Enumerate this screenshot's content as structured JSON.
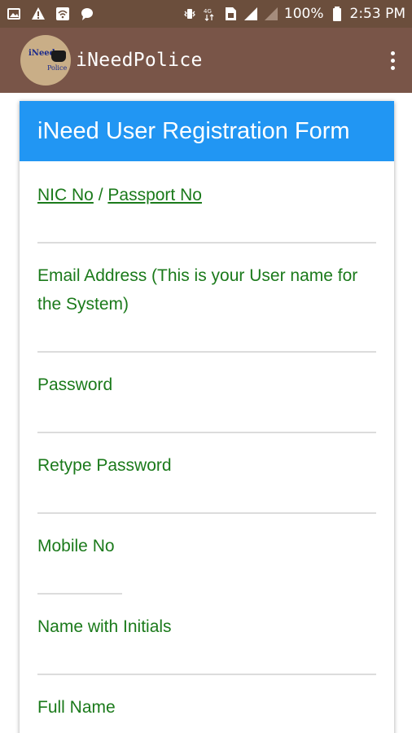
{
  "status_bar": {
    "battery": "100%",
    "time": "2:53 PM"
  },
  "app_bar": {
    "title": "iNeedPolice",
    "logo_top": "iNeed",
    "logo_bottom": "Police"
  },
  "form": {
    "title": "iNeed User Registration Form",
    "nic_label": "NIC No",
    "separator": "/",
    "passport_label": "Passport No",
    "email_label": "Email Address (This is your User name for the System)",
    "password_label": "Password",
    "retype_password_label": "Retype Password",
    "mobile_label": "Mobile No",
    "name_initials_label": "Name with Initials",
    "full_name_label": "Full Name"
  },
  "colors": {
    "status_bar": "#6b4e3c",
    "app_bar": "#795548",
    "form_header": "#2196f3",
    "label_text": "#1b7a1b"
  }
}
